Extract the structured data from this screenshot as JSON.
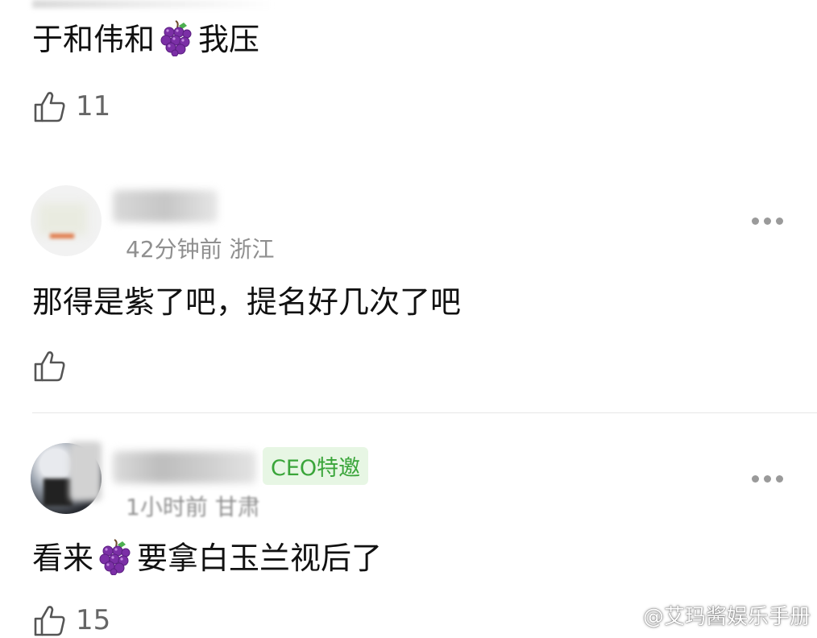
{
  "comments": [
    {
      "text_before": "于和伟和",
      "emoji": "grapes-emoji",
      "text_after": "我压",
      "like_count": "11"
    },
    {
      "time": "42分钟前",
      "location": "浙江",
      "text": "那得是紫了吧，提名好几次了吧",
      "like_count": ""
    },
    {
      "badge": "CEO特邀",
      "time": "1小时前",
      "location": "甘肃",
      "text_before": "看来",
      "emoji": "grapes-emoji",
      "text_after": "要拿白玉兰视后了",
      "like_count": "15"
    }
  ],
  "watermark": {
    "text": "@艾玛酱娱乐手册"
  },
  "colors": {
    "badge_bg": "#e7f6e4",
    "badge_text": "#3aa53a",
    "meta_text": "#8f8f8f"
  }
}
